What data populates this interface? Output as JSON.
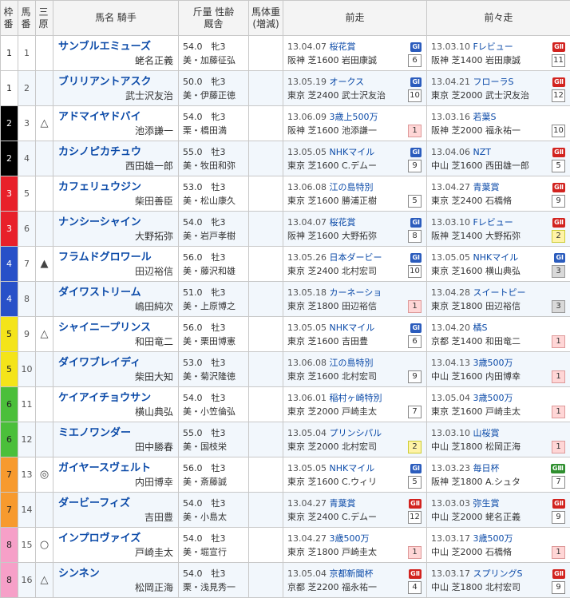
{
  "headers": {
    "waku": [
      "枠",
      "番"
    ],
    "uma": [
      "馬",
      "番"
    ],
    "mark": [
      "三",
      "原"
    ],
    "horse": "馬名 騎手",
    "info": [
      "斤量 性齢",
      "厩舎"
    ],
    "weight": [
      "馬体重",
      "(増減)"
    ],
    "prev": "前走",
    "prev2": "前々走"
  },
  "colors": {
    "waku": [
      "#ffffff",
      "#000000",
      "#e8202a",
      "#2850c8",
      "#f4e41a",
      "#4bbf3a",
      "#f79a2e",
      "#f6a0c8"
    ],
    "waku_text": [
      "#222222",
      "#ffffff",
      "#ffffff",
      "#ffffff",
      "#222222",
      "#222222",
      "#222222",
      "#222222"
    ]
  },
  "rows": [
    {
      "waku": "1",
      "uma": "1",
      "mark": "",
      "name": "サンブルエミューズ",
      "jockey": "蛯名正義",
      "info1": "54.0　牝3",
      "info2": "美・加藤征弘",
      "prev": {
        "date": "13.04.07",
        "race": "桜花賞",
        "grade": "GⅠ",
        "cond": "阪神 芝1600 岩田康誠",
        "pos": "6"
      },
      "prev2": {
        "date": "13.03.10",
        "race": "Fレビュー",
        "grade": "GⅡ",
        "cond": "阪神 芝1400 岩田康誠",
        "pos": "11"
      }
    },
    {
      "waku": "1",
      "uma": "2",
      "mark": "",
      "name": "ブリリアントアスク",
      "jockey": "武士沢友治",
      "info1": "50.0　牝3",
      "info2": "美・伊藤正徳",
      "prev": {
        "date": "13.05.19",
        "race": "オークス",
        "grade": "GⅠ",
        "cond": "東京 芝2400 武士沢友治",
        "pos": "10"
      },
      "prev2": {
        "date": "13.04.21",
        "race": "フローラS",
        "grade": "GⅡ",
        "cond": "東京 芝2000 武士沢友治",
        "pos": "12"
      }
    },
    {
      "waku": "2",
      "uma": "3",
      "mark": "△",
      "name": "アドマイヤドバイ",
      "jockey": "池添謙一",
      "info1": "54.0　牝3",
      "info2": "栗・橋田満",
      "prev": {
        "date": "13.06.09",
        "race": "3歳上500万",
        "grade": "",
        "cond": "阪神 芝1600 池添謙一",
        "pos": "1"
      },
      "prev2": {
        "date": "13.03.16",
        "race": "若葉S",
        "grade": "",
        "cond": "阪神 芝2000 福永祐一",
        "pos": "10"
      }
    },
    {
      "waku": "2",
      "uma": "4",
      "mark": "",
      "name": "カシノピカチュウ",
      "jockey": "西田雄一郎",
      "info1": "55.0　牡3",
      "info2": "美・牧田和弥",
      "prev": {
        "date": "13.05.05",
        "race": "NHKマイル",
        "grade": "GⅠ",
        "cond": "東京 芝1600 C.デムー",
        "pos": "9"
      },
      "prev2": {
        "date": "13.04.06",
        "race": "NZT",
        "grade": "GⅡ",
        "cond": "中山 芝1600 西田雄一郎",
        "pos": "5"
      }
    },
    {
      "waku": "3",
      "uma": "5",
      "mark": "",
      "name": "カフェリュウジン",
      "jockey": "柴田善臣",
      "info1": "53.0　牡3",
      "info2": "美・松山康久",
      "prev": {
        "date": "13.06.08",
        "race": "江の島特別",
        "grade": "",
        "cond": "東京 芝1600 勝浦正樹",
        "pos": "5"
      },
      "prev2": {
        "date": "13.04.27",
        "race": "青葉賞",
        "grade": "GⅡ",
        "cond": "東京 芝2400 石橋脩",
        "pos": "9"
      }
    },
    {
      "waku": "3",
      "uma": "6",
      "mark": "",
      "name": "ナンシーシャイン",
      "jockey": "大野拓弥",
      "info1": "54.0　牝3",
      "info2": "美・岩戸孝樹",
      "prev": {
        "date": "13.04.07",
        "race": "桜花賞",
        "grade": "GⅠ",
        "cond": "阪神 芝1600 大野拓弥",
        "pos": "8"
      },
      "prev2": {
        "date": "13.03.10",
        "race": "Fレビュー",
        "grade": "GⅡ",
        "cond": "阪神 芝1400 大野拓弥",
        "pos": "2"
      }
    },
    {
      "waku": "4",
      "uma": "7",
      "mark": "▲",
      "name": "フラムドグロワール",
      "jockey": "田辺裕信",
      "info1": "56.0　牡3",
      "info2": "美・藤沢和雄",
      "prev": {
        "date": "13.05.26",
        "race": "日本ダービー",
        "grade": "GⅠ",
        "cond": "東京 芝2400 北村宏司",
        "pos": "10"
      },
      "prev2": {
        "date": "13.05.05",
        "race": "NHKマイル",
        "grade": "GⅠ",
        "cond": "東京 芝1600 横山典弘",
        "pos": "3"
      }
    },
    {
      "waku": "4",
      "uma": "8",
      "mark": "",
      "name": "ダイワストリーム",
      "jockey": "嶋田純次",
      "info1": "51.0　牝3",
      "info2": "美・上原博之",
      "prev": {
        "date": "13.05.18",
        "race": "カーネーショ",
        "grade": "",
        "cond": "東京 芝1800 田辺裕信",
        "pos": "1"
      },
      "prev2": {
        "date": "13.04.28",
        "race": "スイートピー",
        "grade": "",
        "cond": "東京 芝1800 田辺裕信",
        "pos": "3"
      }
    },
    {
      "waku": "5",
      "uma": "9",
      "mark": "△",
      "name": "シャイニープリンス",
      "jockey": "和田竜二",
      "info1": "56.0　牡3",
      "info2": "美・栗田博憲",
      "prev": {
        "date": "13.05.05",
        "race": "NHKマイル",
        "grade": "GⅠ",
        "cond": "東京 芝1600 吉田豊",
        "pos": "6"
      },
      "prev2": {
        "date": "13.04.20",
        "race": "橘S",
        "grade": "",
        "cond": "京都 芝1400 和田竜二",
        "pos": "1"
      }
    },
    {
      "waku": "5",
      "uma": "10",
      "mark": "",
      "name": "ダイワブレイディ",
      "jockey": "柴田大知",
      "info1": "53.0　牡3",
      "info2": "美・菊沢隆徳",
      "prev": {
        "date": "13.06.08",
        "race": "江の島特別",
        "grade": "",
        "cond": "東京 芝1600 北村宏司",
        "pos": "9"
      },
      "prev2": {
        "date": "13.04.13",
        "race": "3歳500万",
        "grade": "",
        "cond": "中山 芝1600 内田博幸",
        "pos": "1"
      }
    },
    {
      "waku": "6",
      "uma": "11",
      "mark": "",
      "name": "ケイアイチョウサン",
      "jockey": "横山典弘",
      "info1": "54.0　牡3",
      "info2": "美・小笠倫弘",
      "prev": {
        "date": "13.06.01",
        "race": "稲村ヶ崎特別",
        "grade": "",
        "cond": "東京 芝2000 戸崎圭太",
        "pos": "7"
      },
      "prev2": {
        "date": "13.05.04",
        "race": "3歳500万",
        "grade": "",
        "cond": "東京 芝1600 戸崎圭太",
        "pos": "1"
      }
    },
    {
      "waku": "6",
      "uma": "12",
      "mark": "",
      "name": "ミエノワンダー",
      "jockey": "田中勝春",
      "info1": "55.0　牡3",
      "info2": "美・国枝栄",
      "prev": {
        "date": "13.05.04",
        "race": "プリンシパル",
        "grade": "",
        "cond": "東京 芝2000 北村宏司",
        "pos": "2"
      },
      "prev2": {
        "date": "13.03.10",
        "race": "山桜賞",
        "grade": "",
        "cond": "中山 芝1800 松岡正海",
        "pos": "1"
      }
    },
    {
      "waku": "7",
      "uma": "13",
      "mark": "◎",
      "name": "ガイヤースヴェルト",
      "jockey": "内田博幸",
      "info1": "56.0　牡3",
      "info2": "美・斎藤誠",
      "prev": {
        "date": "13.05.05",
        "race": "NHKマイル",
        "grade": "GⅠ",
        "cond": "東京 芝1600 C.ウィリ",
        "pos": "5"
      },
      "prev2": {
        "date": "13.03.23",
        "race": "毎日杯",
        "grade": "GⅢ",
        "cond": "阪神 芝1800 A.シュタ",
        "pos": "7"
      }
    },
    {
      "waku": "7",
      "uma": "14",
      "mark": "",
      "name": "ダービーフィズ",
      "jockey": "吉田豊",
      "info1": "54.0　牡3",
      "info2": "美・小島太",
      "prev": {
        "date": "13.04.27",
        "race": "青葉賞",
        "grade": "GⅡ",
        "cond": "東京 芝2400 C.デムー",
        "pos": "12"
      },
      "prev2": {
        "date": "13.03.03",
        "race": "弥生賞",
        "grade": "GⅡ",
        "cond": "中山 芝2000 蛯名正義",
        "pos": "9"
      }
    },
    {
      "waku": "8",
      "uma": "15",
      "mark": "○",
      "name": "インプロヴァイズ",
      "jockey": "戸崎圭太",
      "info1": "54.0　牡3",
      "info2": "美・堀宣行",
      "prev": {
        "date": "13.04.27",
        "race": "3歳500万",
        "grade": "",
        "cond": "東京 芝1800 戸崎圭太",
        "pos": "1"
      },
      "prev2": {
        "date": "13.03.17",
        "race": "3歳500万",
        "grade": "",
        "cond": "中山 芝2000 石橋脩",
        "pos": "1"
      }
    },
    {
      "waku": "8",
      "uma": "16",
      "mark": "△",
      "name": "シンネン",
      "jockey": "松岡正海",
      "info1": "54.0　牡3",
      "info2": "栗・浅見秀一",
      "prev": {
        "date": "13.05.04",
        "race": "京都新聞杯",
        "grade": "GⅡ",
        "cond": "京都 芝2200 福永祐一",
        "pos": "4"
      },
      "prev2": {
        "date": "13.03.17",
        "race": "スプリングS",
        "grade": "GⅡ",
        "cond": "中山 芝1800 北村宏司",
        "pos": "9"
      }
    }
  ]
}
